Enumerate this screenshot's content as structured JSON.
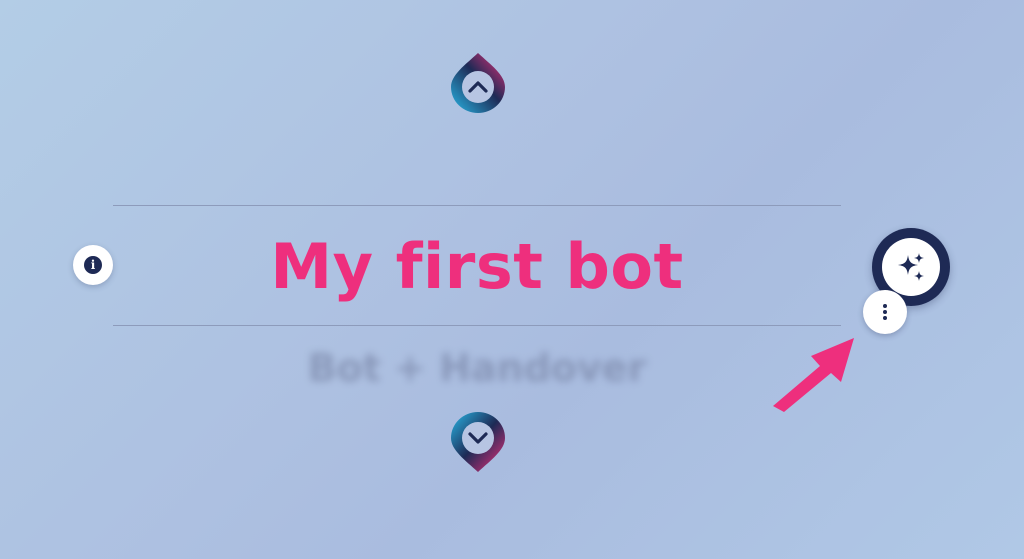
{
  "bot": {
    "title": "My first bot",
    "next_bot_name": "Bot + Handover"
  },
  "icons": {
    "nav_up": "chevron-up-icon",
    "nav_down": "chevron-down-icon",
    "info": "info-icon",
    "ai": "sparkles-icon",
    "more": "more-vertical-icon",
    "arrow": "arrow-pointer-icon"
  },
  "info_glyph": "i",
  "colors": {
    "accent": "#ee2f7d",
    "dark": "#1e2a55",
    "gradient_start": "#28b6e6",
    "gradient_end": "#f0307c"
  }
}
